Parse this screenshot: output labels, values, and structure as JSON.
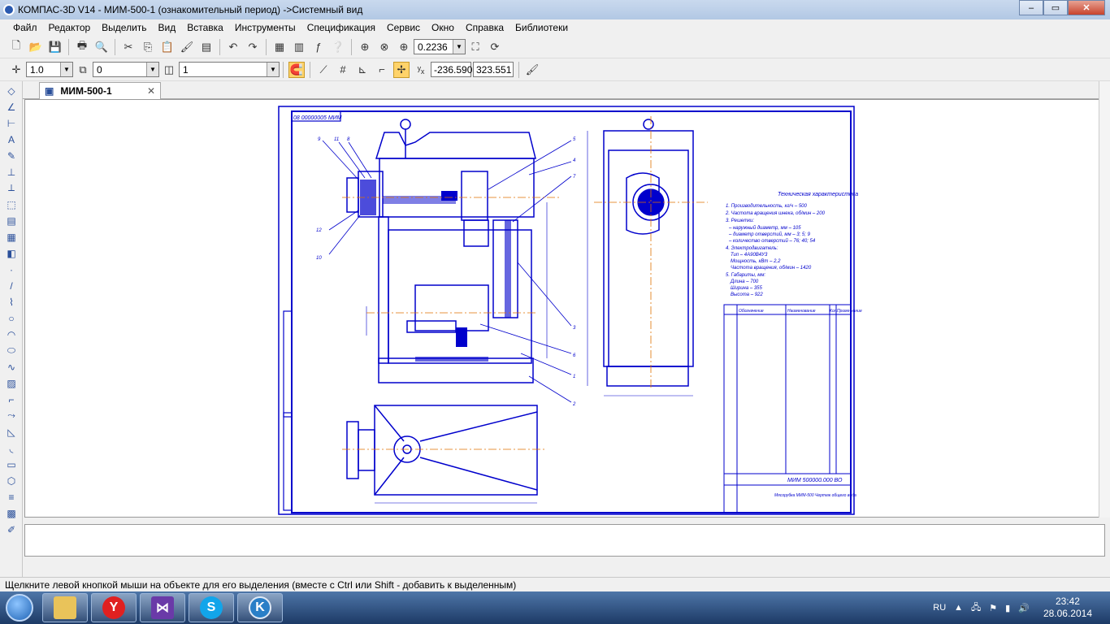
{
  "window": {
    "title": "КОМПАС-3D V14 - МИМ-500-1 (ознакомительный период) ->Системный вид",
    "controls": [
      "–",
      "▭",
      "✕"
    ]
  },
  "menu": [
    "Файл",
    "Редактор",
    "Выделить",
    "Вид",
    "Вставка",
    "Инструменты",
    "Сервис",
    "Спецификация",
    "Сервис",
    "Окно",
    "Справка",
    "Библиотеки"
  ],
  "toolbar": {
    "zoom_value": "0.2236",
    "line_weight": "1.0",
    "layer": "0",
    "style": "1",
    "coord_x": "-236.590",
    "coord_y": "323.551"
  },
  "document": {
    "tab_label": "МИМ-500-1",
    "tab_close": "✕"
  },
  "drawing": {
    "stamp_top": "08 00000005 МИМ",
    "tech_title": "Техническая характеристика",
    "tech_specs": [
      "1. Производительность, кг/ч – 500",
      "2. Частота вращения шнека, об/мин – 200",
      "3. Решетки:",
      "– наружный диаметр, мм – 105",
      "– диаметр отверстий, мм – 3; 5; 9",
      "– количество отверстий – 76; 40; 54",
      "4. Электродвигатель:",
      "Тип – 4А90В4У3",
      "Мощность, кВт – 2,2",
      "Частота вращения, об/мин – 1420",
      "5. Габариты, мм:",
      "Длина – 700",
      "Ширина – 355",
      "Высота – 922"
    ],
    "spec_header": [
      "Обозначение",
      "Наименование",
      "Кол.",
      "Приме-чание"
    ],
    "title_code": "МИМ 500000.000 ВО",
    "title_name": "Мясорубка МИМ-500 Чертеж общего вида",
    "callouts": [
      "9",
      "11",
      "8",
      "12",
      "10",
      "5",
      "4",
      "7",
      "3",
      "6",
      "1",
      "2"
    ]
  },
  "statusbar": {
    "hint": "Щелкните левой кнопкой мыши на объекте для его выделения (вместе с Ctrl или Shift - добавить к выделенным)"
  },
  "taskbar": {
    "lang": "RU",
    "time": "23:42",
    "date": "28.06.2014"
  },
  "colors": {
    "drawing": "#0000cc",
    "axis": "#e07000",
    "titlebar": "#b2c8e4"
  }
}
